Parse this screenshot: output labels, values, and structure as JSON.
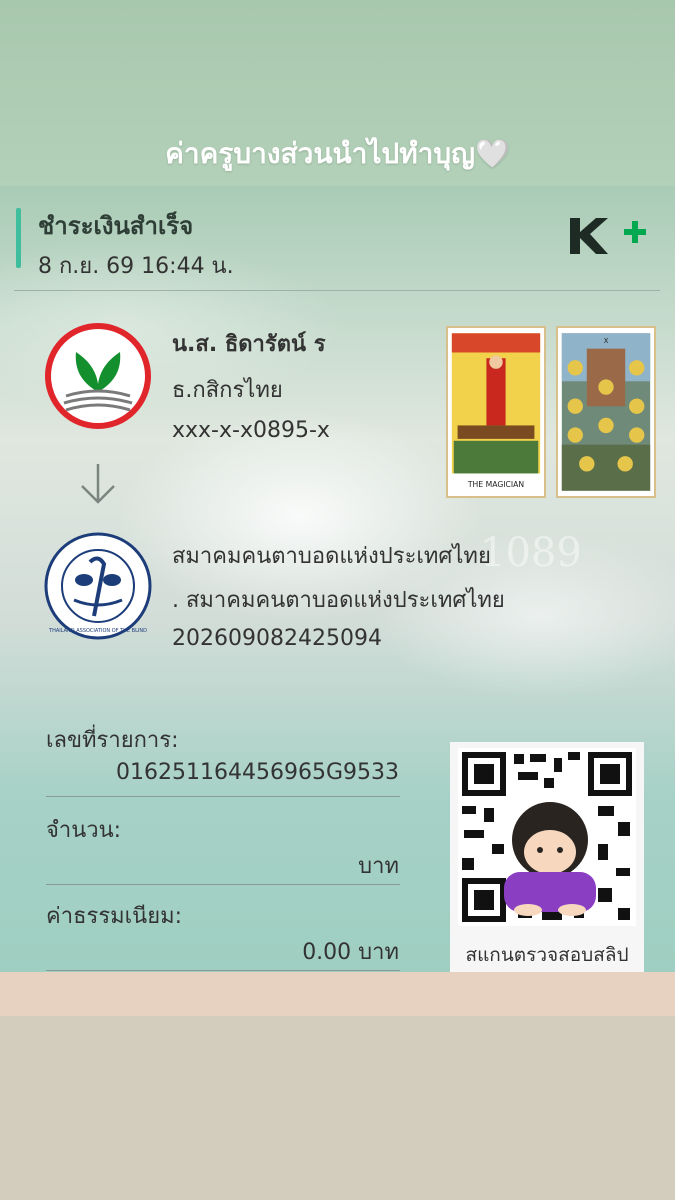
{
  "story": {
    "caption": "ค่าครูบางส่วนนำไปทำบุญ🤍"
  },
  "slip": {
    "status": "ชำระเงินสำเร็จ",
    "datetime": "8 ก.ย. 69  16:44 น.",
    "sender": {
      "name": "น.ส. ธิดารัตน์ ร",
      "bank": "ธ.กสิกรไทย",
      "account": "xxx-x-x0895-x"
    },
    "recipient": {
      "name": "สมาคมคนตาบอดแห่งประเทศไทย",
      "bank": ". สมาคมคนตาบอดแห่งประเทศไทย",
      "account": "202609082425094",
      "watermark": "1089",
      "logo_text": "THAILAND ASSOCIATION OF THE BLIND"
    },
    "fields": [
      {
        "label": "เลขที่รายการ:",
        "value": "016251164456965G9533"
      },
      {
        "label": "จำนวน:",
        "value": "บาท"
      },
      {
        "label": "ค่าธรรมเนียม:",
        "value": "0.00 บาท"
      }
    ],
    "qr_caption": "สแกนตรวจสอบสลิป",
    "tarot": [
      "THE MAGICIAN",
      "X"
    ]
  },
  "colors": {
    "kbank_green": "#138f2d",
    "accent": "#3fbe9d",
    "kplus_plus": "#00a950"
  }
}
